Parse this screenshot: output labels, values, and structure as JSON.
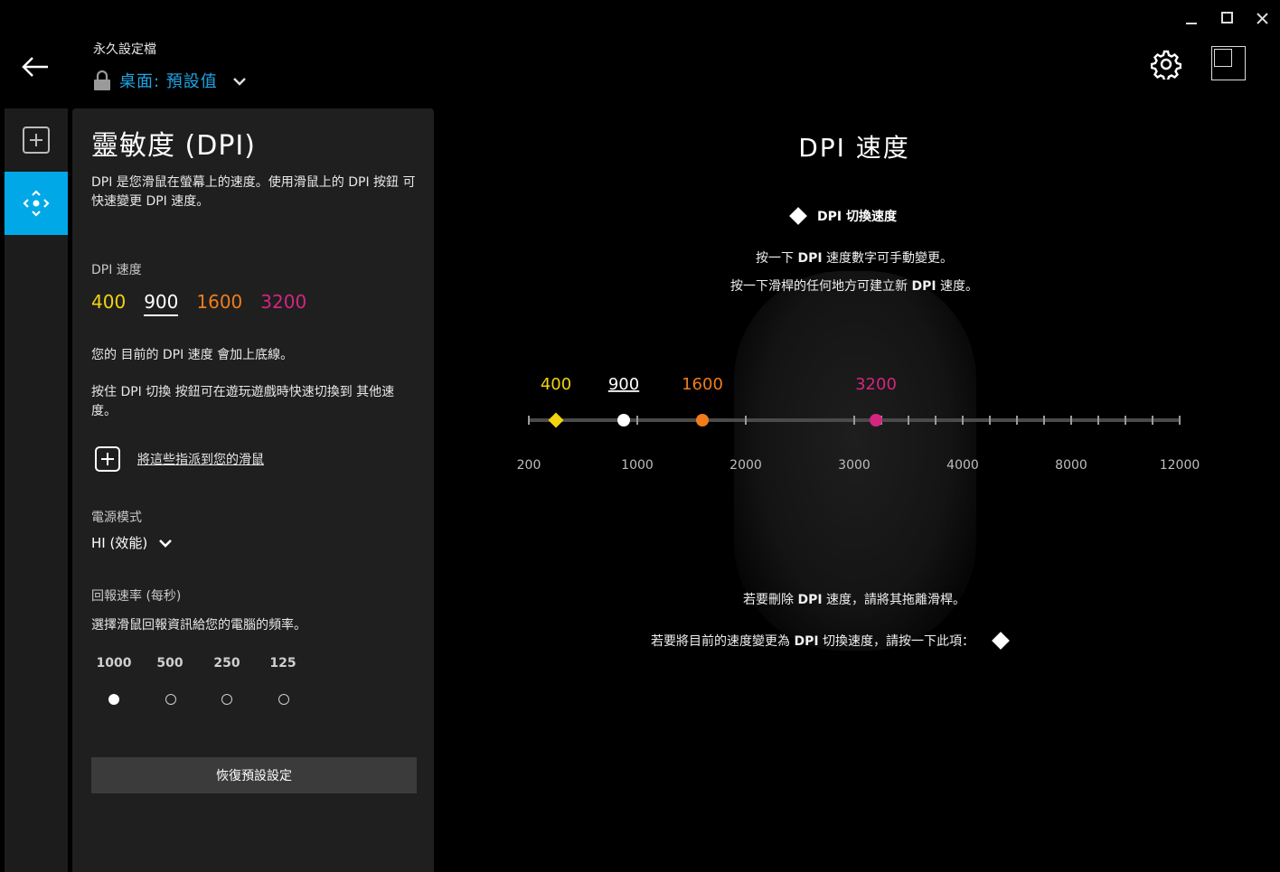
{
  "header": {
    "profile_caption": "永久設定檔",
    "profile_name": "桌面: 預設值"
  },
  "panel": {
    "title": "靈敏度 (DPI)",
    "description": "DPI 是您滑鼠在螢幕上的速度。使用滑鼠上的 DPI 按鈕 可快速變更 DPI 速度。",
    "dpi_label": "DPI 速度",
    "dpi_values": [
      {
        "value": "400",
        "color": "#f2d312"
      },
      {
        "value": "900",
        "color": "#ffffff"
      },
      {
        "value": "1600",
        "color": "#f07d1a"
      },
      {
        "value": "3200",
        "color": "#d42580"
      }
    ],
    "current_dpi": "900",
    "underline_note": "您的 目前的 DPI 速度 會加上底線。",
    "shift_note": "按住 DPI 切換 按鈕可在遊玩遊戲時快速切換到 其他速度。",
    "assign_label": "將這些指派到您的滑鼠",
    "power_label": "電源模式",
    "power_value": "HI (效能)",
    "report_label": "回報速率 (每秒)",
    "report_desc": "選擇滑鼠回報資訊給您的電腦的頻率。",
    "report_rates": [
      "1000",
      "500",
      "250",
      "125"
    ],
    "report_selected": "1000",
    "reset_label": "恢復預設設定"
  },
  "main": {
    "title": "DPI 速度",
    "switch_label": "DPI 切換速度",
    "hint1_pre": "按一下 ",
    "hint1_bold": "DPI",
    "hint1_post": " 速度數字可手動變更。",
    "hint2_pre": "按一下滑桿的任何地方可建立新 ",
    "hint2_bold": "DPI",
    "hint2_post": " 速度。",
    "delete_pre": "若要刪除 ",
    "delete_bold": "DPI",
    "delete_post": " 速度，請將其拖離滑桿。",
    "switch_pre": "若要將目前的速度變更為 ",
    "switch_bold": "DPI",
    "switch_post": " 切換速度，請按一下此項："
  },
  "slider": {
    "scale_labels": [
      "200",
      "1000",
      "2000",
      "3000",
      "4000",
      "8000",
      "12000"
    ],
    "markers": [
      {
        "label": "400",
        "dpi": 400,
        "color": "#f2d312",
        "shape": "diamond"
      },
      {
        "label": "900",
        "dpi": 900,
        "color": "#ffffff",
        "shape": "circle"
      },
      {
        "label": "1600",
        "dpi": 1600,
        "color": "#f07d1a",
        "shape": "circle"
      },
      {
        "label": "3200",
        "dpi": 3200,
        "color": "#d42580",
        "shape": "circle"
      }
    ]
  },
  "colors": {
    "accent": "#00a8e8",
    "profile_link": "#1ea5e6"
  }
}
